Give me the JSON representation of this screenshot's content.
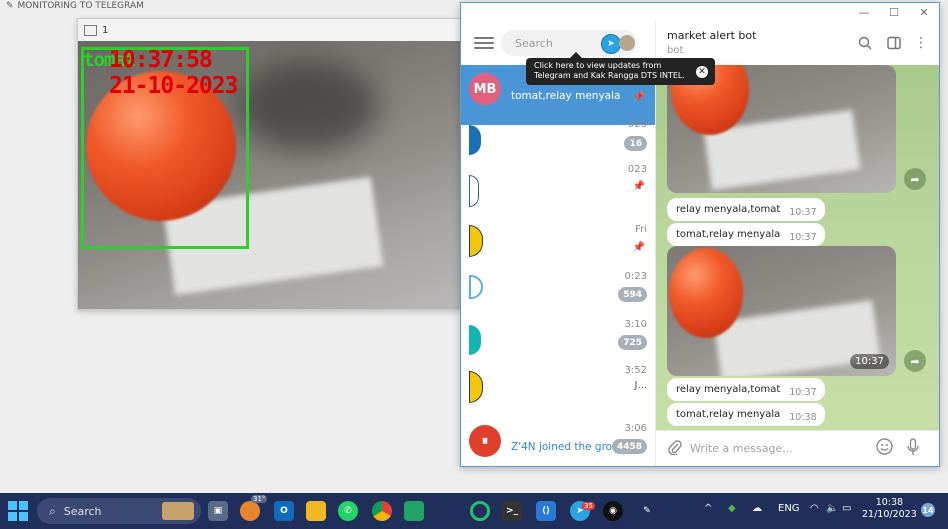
{
  "background_app": {
    "title": "MONITORING TO TELEGRAM"
  },
  "camera_window": {
    "title": "1",
    "detection_label": "tomat",
    "overlay_time": "10:37:58",
    "overlay_date": "21-10-2023"
  },
  "telegram": {
    "search": {
      "placeholder": "Search"
    },
    "tooltip": {
      "line1": "Click here to view updates from",
      "line2": "Telegram and Kak Rangga DTS INTEL."
    },
    "chats": [
      {
        "avatar_text": "MB",
        "preview": "tomat,relay menyala",
        "active": true
      },
      {
        "time": "023",
        "badge": "16"
      },
      {
        "time": "023"
      },
      {
        "time": "Fri"
      },
      {
        "time": "0:23",
        "badge": "594"
      },
      {
        "time": "3:10",
        "badge": "725"
      },
      {
        "time": "3:52",
        "preview": "J..."
      },
      {
        "time": "3:06",
        "preview": "Z'4N joined the group...",
        "badge": "4458"
      }
    ],
    "chat": {
      "name": "market alert bot",
      "status": "bot",
      "messages": [
        {
          "text": "relay menyala,tomat",
          "time": "10:37"
        },
        {
          "text": "tomat,relay menyala",
          "time": "10:37"
        },
        {
          "photo_time": "10:37"
        },
        {
          "text": "relay menyala,tomat",
          "time": "10:37"
        },
        {
          "text": "tomat,relay menyala",
          "time": "10:38"
        }
      ],
      "composer_placeholder": "Write a message..."
    }
  },
  "taskbar": {
    "search_label": "Search",
    "weather_temp": "31°",
    "language": "ENG",
    "time": "10:38",
    "date": "21/10/2023",
    "notification_count": "14",
    "telegram_badge": "35"
  }
}
